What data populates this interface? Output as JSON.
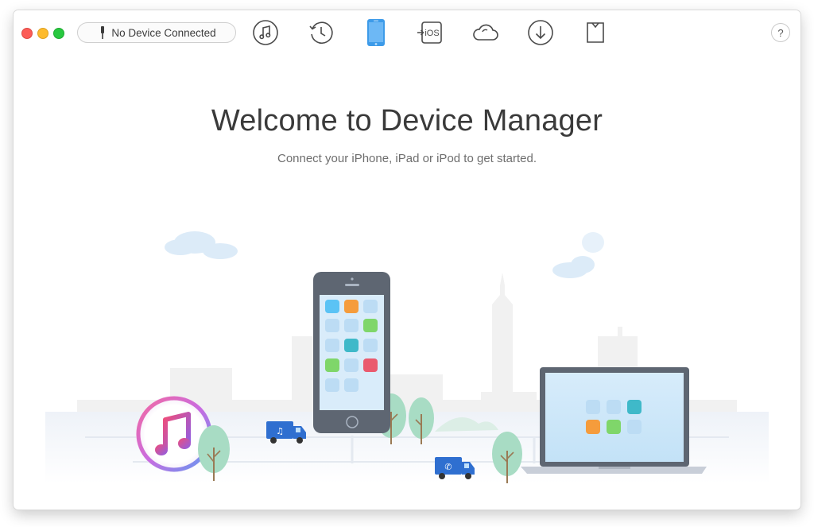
{
  "window": {
    "controls": [
      "close",
      "minimize",
      "zoom"
    ]
  },
  "toolbar": {
    "device_status": "No Device Connected",
    "cable_icon": "lightning-cable-icon",
    "tools": [
      {
        "name": "music-manager",
        "icon": "music-note-icon",
        "active": false
      },
      {
        "name": "backup-history",
        "icon": "history-clock-icon",
        "active": false
      },
      {
        "name": "device-manager",
        "icon": "phone-icon",
        "active": true
      },
      {
        "name": "ios-mover",
        "icon": "ios-transfer-icon",
        "active": false
      },
      {
        "name": "icloud-manager",
        "icon": "cloud-icon",
        "active": false
      },
      {
        "name": "media-downloader",
        "icon": "download-circle-icon",
        "active": false
      },
      {
        "name": "toolkit",
        "icon": "shirt-icon",
        "active": false
      }
    ],
    "help_label": "?",
    "ios_label": "iOS"
  },
  "main": {
    "title": "Welcome to Device Manager",
    "subtitle": "Connect your iPhone, iPad or iPod to get started."
  },
  "colors": {
    "accent": "#3d9be9",
    "icon_stroke": "#4a4a4a",
    "app_tile_blue": "#5bc3f5",
    "app_tile_orange": "#f59c3c",
    "app_tile_green": "#7fd66a",
    "app_tile_teal": "#3fb9c9",
    "app_tile_red": "#ea5a6e",
    "tree_green": "#a8dcc4",
    "truck_blue": "#2f6fd0"
  }
}
